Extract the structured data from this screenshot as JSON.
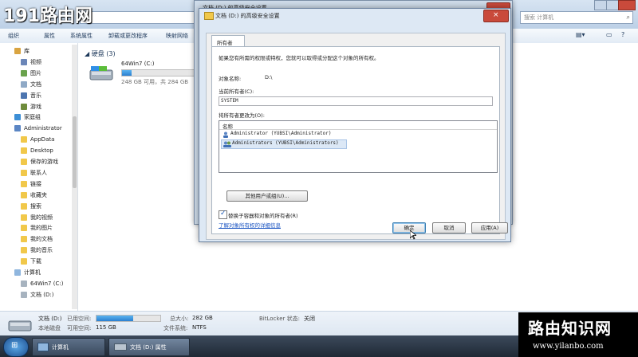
{
  "explorer": {
    "search_placeholder": "搜索 计算机",
    "toolbar": [
      "组织",
      "属性",
      "系统属性",
      "卸载或更改程序",
      "映射网络"
    ],
    "nav": [
      {
        "label": "库",
        "icon": "library-icon",
        "indent": 0
      },
      {
        "label": "视频",
        "icon": "video-icon",
        "indent": 1
      },
      {
        "label": "图片",
        "icon": "pictures-icon",
        "indent": 1
      },
      {
        "label": "文档",
        "icon": "documents-icon",
        "indent": 1
      },
      {
        "label": "音乐",
        "icon": "music-icon",
        "indent": 1
      },
      {
        "label": "游戏",
        "icon": "games-icon",
        "indent": 1
      },
      {
        "label": "家庭组",
        "icon": "homegroup-icon",
        "indent": 0
      },
      {
        "label": "Administrator",
        "icon": "user-icon",
        "indent": 0
      },
      {
        "label": "AppData",
        "icon": "folder-icon",
        "indent": 1
      },
      {
        "label": "Desktop",
        "icon": "folder-icon",
        "indent": 1
      },
      {
        "label": "保存的游戏",
        "icon": "folder-icon",
        "indent": 1
      },
      {
        "label": "联系人",
        "icon": "folder-icon",
        "indent": 1
      },
      {
        "label": "链接",
        "icon": "folder-icon",
        "indent": 1
      },
      {
        "label": "收藏夹",
        "icon": "folder-icon",
        "indent": 1
      },
      {
        "label": "搜索",
        "icon": "folder-icon",
        "indent": 1
      },
      {
        "label": "我的视频",
        "icon": "folder-icon",
        "indent": 1
      },
      {
        "label": "我的图片",
        "icon": "folder-icon",
        "indent": 1
      },
      {
        "label": "我的文档",
        "icon": "folder-icon",
        "indent": 1
      },
      {
        "label": "我的音乐",
        "icon": "folder-icon",
        "indent": 1
      },
      {
        "label": "下载",
        "icon": "folder-icon",
        "indent": 1
      },
      {
        "label": "计算机",
        "icon": "computer-icon",
        "indent": 0
      },
      {
        "label": "64Win7 (C:)",
        "icon": "drive-icon",
        "indent": 1
      },
      {
        "label": "文档 (D:)",
        "icon": "drive-icon",
        "indent": 1
      }
    ],
    "section_title": "硬盘 (3)",
    "drive": {
      "name": "64Win7 (C:)",
      "free_text": "248 GB 可用，共 284 GB",
      "used_fraction": 0.13
    },
    "status": {
      "name": "文档 (D:)",
      "used_label": "已用空间:",
      "used_fraction": 0.58,
      "type": "本地磁盘",
      "free_label": "可用空间:",
      "free_value": "115 GB",
      "total_label": "总大小:",
      "total_value": "282 GB",
      "fs_label": "文件系统:",
      "fs_value": "NTFS",
      "bitlocker_label": "BitLocker 状态:",
      "bitlocker_value": "关闭"
    }
  },
  "back_dialog": {
    "title": "文档 (D:) 的高级安全设置"
  },
  "dialog": {
    "title": "文档 (D:) 的高级安全设置",
    "tab": "所有者",
    "instruction": "如果您有所需的权限或特权，您就可以取得或分配这个对象的所有权。",
    "object_label": "对象名称:",
    "object_value": "D:\\",
    "current_owner_label": "当前所有者(C):",
    "current_owner_value": "SYSTEM",
    "change_owner_label": "将所有者更改为(O):",
    "list_header": "名称",
    "list_items": [
      {
        "name": "Administrator (YUBSI\\Administrator)",
        "icon": "user-icon"
      },
      {
        "name": "Administrators (YUBSI\\Administrators)",
        "icon": "group-icon"
      }
    ],
    "other_users_button": "其他用户或组(U)...",
    "replace_checkbox": "替换子容器和对象的所有者(R)",
    "replace_checked": true,
    "link": "了解对象所有权的详细信息",
    "ok": "确定",
    "cancel": "取消",
    "apply": "应用(A)"
  },
  "taskbar": {
    "items": [
      {
        "label": "计算机",
        "icon": "computer-icon"
      },
      {
        "label": "文档 (D:) 属性",
        "icon": "drive-icon"
      }
    ]
  },
  "watermarks": {
    "top_left": "191路由网",
    "bottom_right_title": "路由知识网",
    "bottom_right_url": "www.yilanbo.com"
  }
}
